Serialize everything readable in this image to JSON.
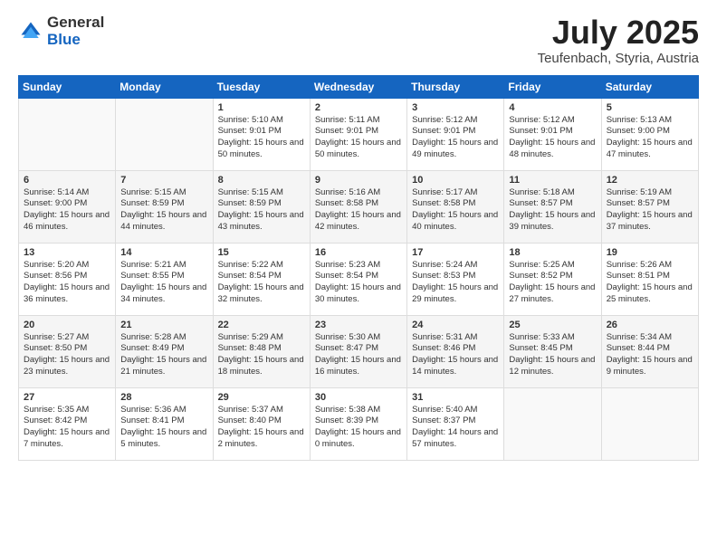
{
  "logo": {
    "general": "General",
    "blue": "Blue"
  },
  "title": "July 2025",
  "location": "Teufenbach, Styria, Austria",
  "days_of_week": [
    "Sunday",
    "Monday",
    "Tuesday",
    "Wednesday",
    "Thursday",
    "Friday",
    "Saturday"
  ],
  "weeks": [
    [
      {
        "day": "",
        "sunrise": "",
        "sunset": "",
        "daylight": ""
      },
      {
        "day": "",
        "sunrise": "",
        "sunset": "",
        "daylight": ""
      },
      {
        "day": "1",
        "sunrise": "Sunrise: 5:10 AM",
        "sunset": "Sunset: 9:01 PM",
        "daylight": "Daylight: 15 hours and 50 minutes."
      },
      {
        "day": "2",
        "sunrise": "Sunrise: 5:11 AM",
        "sunset": "Sunset: 9:01 PM",
        "daylight": "Daylight: 15 hours and 50 minutes."
      },
      {
        "day": "3",
        "sunrise": "Sunrise: 5:12 AM",
        "sunset": "Sunset: 9:01 PM",
        "daylight": "Daylight: 15 hours and 49 minutes."
      },
      {
        "day": "4",
        "sunrise": "Sunrise: 5:12 AM",
        "sunset": "Sunset: 9:01 PM",
        "daylight": "Daylight: 15 hours and 48 minutes."
      },
      {
        "day": "5",
        "sunrise": "Sunrise: 5:13 AM",
        "sunset": "Sunset: 9:00 PM",
        "daylight": "Daylight: 15 hours and 47 minutes."
      }
    ],
    [
      {
        "day": "6",
        "sunrise": "Sunrise: 5:14 AM",
        "sunset": "Sunset: 9:00 PM",
        "daylight": "Daylight: 15 hours and 46 minutes."
      },
      {
        "day": "7",
        "sunrise": "Sunrise: 5:15 AM",
        "sunset": "Sunset: 8:59 PM",
        "daylight": "Daylight: 15 hours and 44 minutes."
      },
      {
        "day": "8",
        "sunrise": "Sunrise: 5:15 AM",
        "sunset": "Sunset: 8:59 PM",
        "daylight": "Daylight: 15 hours and 43 minutes."
      },
      {
        "day": "9",
        "sunrise": "Sunrise: 5:16 AM",
        "sunset": "Sunset: 8:58 PM",
        "daylight": "Daylight: 15 hours and 42 minutes."
      },
      {
        "day": "10",
        "sunrise": "Sunrise: 5:17 AM",
        "sunset": "Sunset: 8:58 PM",
        "daylight": "Daylight: 15 hours and 40 minutes."
      },
      {
        "day": "11",
        "sunrise": "Sunrise: 5:18 AM",
        "sunset": "Sunset: 8:57 PM",
        "daylight": "Daylight: 15 hours and 39 minutes."
      },
      {
        "day": "12",
        "sunrise": "Sunrise: 5:19 AM",
        "sunset": "Sunset: 8:57 PM",
        "daylight": "Daylight: 15 hours and 37 minutes."
      }
    ],
    [
      {
        "day": "13",
        "sunrise": "Sunrise: 5:20 AM",
        "sunset": "Sunset: 8:56 PM",
        "daylight": "Daylight: 15 hours and 36 minutes."
      },
      {
        "day": "14",
        "sunrise": "Sunrise: 5:21 AM",
        "sunset": "Sunset: 8:55 PM",
        "daylight": "Daylight: 15 hours and 34 minutes."
      },
      {
        "day": "15",
        "sunrise": "Sunrise: 5:22 AM",
        "sunset": "Sunset: 8:54 PM",
        "daylight": "Daylight: 15 hours and 32 minutes."
      },
      {
        "day": "16",
        "sunrise": "Sunrise: 5:23 AM",
        "sunset": "Sunset: 8:54 PM",
        "daylight": "Daylight: 15 hours and 30 minutes."
      },
      {
        "day": "17",
        "sunrise": "Sunrise: 5:24 AM",
        "sunset": "Sunset: 8:53 PM",
        "daylight": "Daylight: 15 hours and 29 minutes."
      },
      {
        "day": "18",
        "sunrise": "Sunrise: 5:25 AM",
        "sunset": "Sunset: 8:52 PM",
        "daylight": "Daylight: 15 hours and 27 minutes."
      },
      {
        "day": "19",
        "sunrise": "Sunrise: 5:26 AM",
        "sunset": "Sunset: 8:51 PM",
        "daylight": "Daylight: 15 hours and 25 minutes."
      }
    ],
    [
      {
        "day": "20",
        "sunrise": "Sunrise: 5:27 AM",
        "sunset": "Sunset: 8:50 PM",
        "daylight": "Daylight: 15 hours and 23 minutes."
      },
      {
        "day": "21",
        "sunrise": "Sunrise: 5:28 AM",
        "sunset": "Sunset: 8:49 PM",
        "daylight": "Daylight: 15 hours and 21 minutes."
      },
      {
        "day": "22",
        "sunrise": "Sunrise: 5:29 AM",
        "sunset": "Sunset: 8:48 PM",
        "daylight": "Daylight: 15 hours and 18 minutes."
      },
      {
        "day": "23",
        "sunrise": "Sunrise: 5:30 AM",
        "sunset": "Sunset: 8:47 PM",
        "daylight": "Daylight: 15 hours and 16 minutes."
      },
      {
        "day": "24",
        "sunrise": "Sunrise: 5:31 AM",
        "sunset": "Sunset: 8:46 PM",
        "daylight": "Daylight: 15 hours and 14 minutes."
      },
      {
        "day": "25",
        "sunrise": "Sunrise: 5:33 AM",
        "sunset": "Sunset: 8:45 PM",
        "daylight": "Daylight: 15 hours and 12 minutes."
      },
      {
        "day": "26",
        "sunrise": "Sunrise: 5:34 AM",
        "sunset": "Sunset: 8:44 PM",
        "daylight": "Daylight: 15 hours and 9 minutes."
      }
    ],
    [
      {
        "day": "27",
        "sunrise": "Sunrise: 5:35 AM",
        "sunset": "Sunset: 8:42 PM",
        "daylight": "Daylight: 15 hours and 7 minutes."
      },
      {
        "day": "28",
        "sunrise": "Sunrise: 5:36 AM",
        "sunset": "Sunset: 8:41 PM",
        "daylight": "Daylight: 15 hours and 5 minutes."
      },
      {
        "day": "29",
        "sunrise": "Sunrise: 5:37 AM",
        "sunset": "Sunset: 8:40 PM",
        "daylight": "Daylight: 15 hours and 2 minutes."
      },
      {
        "day": "30",
        "sunrise": "Sunrise: 5:38 AM",
        "sunset": "Sunset: 8:39 PM",
        "daylight": "Daylight: 15 hours and 0 minutes."
      },
      {
        "day": "31",
        "sunrise": "Sunrise: 5:40 AM",
        "sunset": "Sunset: 8:37 PM",
        "daylight": "Daylight: 14 hours and 57 minutes."
      },
      {
        "day": "",
        "sunrise": "",
        "sunset": "",
        "daylight": ""
      },
      {
        "day": "",
        "sunrise": "",
        "sunset": "",
        "daylight": ""
      }
    ]
  ]
}
